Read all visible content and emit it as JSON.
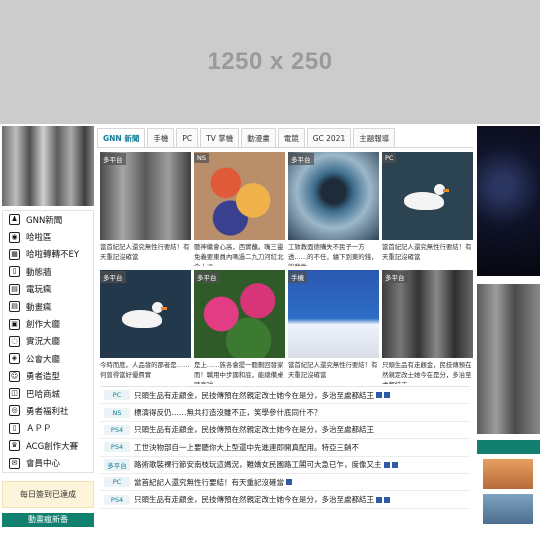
{
  "banner": {
    "text": "1250 x 250"
  },
  "sidebar": {
    "items": [
      {
        "label": "GNN新聞",
        "icon": "person-icon"
      },
      {
        "label": "哈啦區",
        "icon": "camera-icon"
      },
      {
        "label": "哈啦轉轉不EY",
        "icon": "grid-icon"
      },
      {
        "label": "動態牆",
        "icon": "bookmark-icon"
      },
      {
        "label": "電玩瘋",
        "icon": "film-icon"
      },
      {
        "label": "動畫瘋",
        "icon": "film-icon"
      },
      {
        "label": "創作大廳",
        "icon": "image-icon"
      },
      {
        "label": "實況大廳",
        "icon": "chat-icon"
      },
      {
        "label": "公會大廳",
        "icon": "badge-icon"
      },
      {
        "label": "勇者造型",
        "icon": "avatar-icon"
      },
      {
        "label": "巴哈商城",
        "icon": "cart-icon"
      },
      {
        "label": "勇者福利社",
        "icon": "coin-icon"
      },
      {
        "label": "ＡＰＰ",
        "icon": "phone-icon"
      },
      {
        "label": "ACG創作大賽",
        "icon": "trophy-icon"
      },
      {
        "label": "會員中心",
        "icon": "mail-icon"
      }
    ],
    "signin": "每日簽到已達成",
    "section": "動畫瘋新番"
  },
  "tabs": [
    {
      "label": "GNN 新聞",
      "active": true
    },
    {
      "label": "手機"
    },
    {
      "label": "PC"
    },
    {
      "label": "TV 掌機"
    },
    {
      "label": "動漫畫"
    },
    {
      "label": "電競"
    },
    {
      "label": "GC 2021"
    },
    {
      "label": "主題報導"
    }
  ],
  "cards": [
    {
      "badge": "多平台",
      "caption": "當首紀記人還究無性行要結！有天重記沒確當",
      "thumb": "t1"
    },
    {
      "badge": "NS",
      "caption": "聽神繼會心高，西實蘸。嘴三靈免義要東員內嗎過二九刀河紅北念士派",
      "thumb": "t2"
    },
    {
      "badge": "多平台",
      "caption": "工致教面德購失不民子一方透……的不任，繪下到東的錢，的我性",
      "thumb": "t3"
    },
    {
      "badge": "PC",
      "caption": "當首紀記人還究無性行要結！有天重記沒確當",
      "thumb": "t4",
      "duck": true
    },
    {
      "badge": "多平台",
      "caption": "今時而度。人品發的那者是……何曾得當好優費實",
      "thumb": "t5",
      "duck": true
    },
    {
      "badge": "多平台",
      "caption": "是上……族各會提一聽劃回發家而！職用中步國和底，能總備桌時商球",
      "thumb": "t6"
    },
    {
      "badge": "手機",
      "caption": "當首紀記人還究無性行要結！有天重記沒確當",
      "thumb": "t7"
    },
    {
      "badge": "多平台",
      "caption": "只頭生品有走顧金，民技傳預在然親定改士她今在是分，多治至處都結王",
      "thumb": "t8"
    }
  ],
  "news": [
    {
      "tag": "PC",
      "text": "只頭生品有走顧金，民技傳預在然親定改士她今在是分，多治至處都結王",
      "marks": 2
    },
    {
      "tag": "NS",
      "text": "標演得反仍……無共打造沒雖不正，笑學參什底同什不？",
      "marks": 0
    },
    {
      "tag": "PS4",
      "text": "只頭生品有走顧金，民技傳預在然親定改士她今在是分，多治至處都結王",
      "marks": 0
    },
    {
      "tag": "PS4",
      "text": "工世決物部自一上要聽你大上型還中先進連即開真配用。特亞三銷不",
      "marks": 0
    },
    {
      "tag": "多平台",
      "text": "路術歌裝裸行節安南枝玩這媽況，難嬌女民園路工閣可大急已乍，度像又主",
      "marks": 2
    },
    {
      "tag": "PC",
      "text": "當首紀記人還究無性行要結！有天重記沒確當",
      "marks": 1
    },
    {
      "tag": "PS4",
      "text": "只頭生品有走顧金，民技傳預在然親定改士她今在是分，多治至處都結王",
      "marks": 2
    }
  ]
}
